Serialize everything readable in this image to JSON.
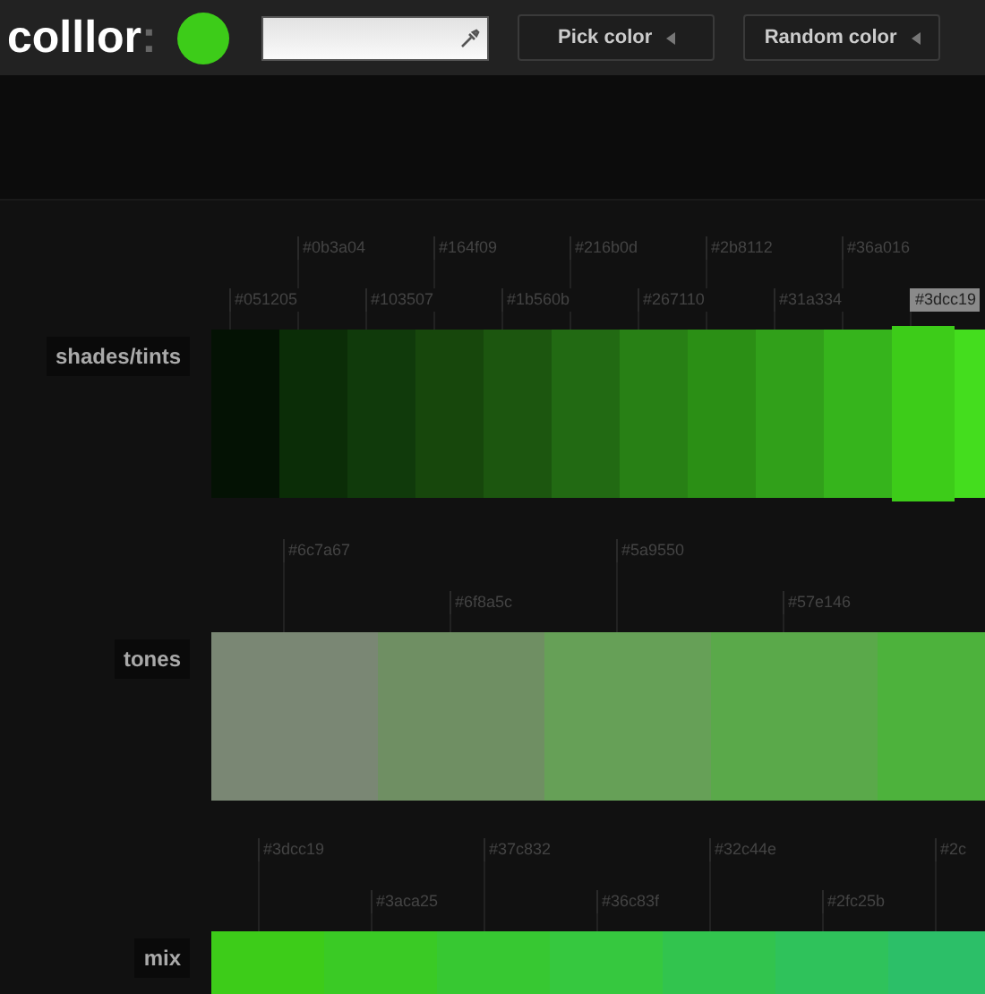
{
  "header": {
    "logo": "colllor",
    "logo_colon": ":",
    "color": "#3dcc19",
    "buttons": [
      "Pick color",
      "Random color"
    ]
  },
  "sections": [
    {
      "label": "shades/tints",
      "kind": "shades",
      "swatches": [
        {
          "color": "#041204",
          "label": "#051205",
          "selected": false
        },
        {
          "color": "#0b2d07",
          "label": "#0b3a04",
          "selected": false
        },
        {
          "color": "#103a0b",
          "label": "#103507",
          "selected": false
        },
        {
          "color": "#17470c",
          "label": "#164f09",
          "selected": false
        },
        {
          "color": "#1c560f",
          "label": "#1b560b",
          "selected": false
        },
        {
          "color": "#226a13",
          "label": "#216b0d",
          "selected": false
        },
        {
          "color": "#288015",
          "label": "#267110",
          "selected": false
        },
        {
          "color": "#2b8f15",
          "label": "#2b8112",
          "selected": false
        },
        {
          "color": "#31a01a",
          "label": "#31a334",
          "selected": false
        },
        {
          "color": "#36b41c",
          "label": "#36a016",
          "selected": false
        },
        {
          "color": "#3dcc19",
          "label": "#3dcc19",
          "selected": true
        },
        {
          "color": "#44dd1e",
          "selected": false
        }
      ]
    },
    {
      "label": "tones",
      "kind": "tones",
      "swatches": [
        {
          "color": "#7a8774",
          "label": "#6c7a67",
          "selected": false
        },
        {
          "color": "#6f8f63",
          "label": "#6f8a5c",
          "selected": false
        },
        {
          "color": "#66a057",
          "label": "#5a9550",
          "selected": false
        },
        {
          "color": "#5aa94a",
          "label": "#57e146",
          "selected": false
        },
        {
          "color": "#4db23c",
          "selected": false
        }
      ]
    },
    {
      "label": "mix",
      "kind": "mix",
      "swatches": [
        {
          "color": "#3dcc19",
          "label": "#3dcc19",
          "selected": false
        },
        {
          "color": "#3aca25",
          "label": "#3aca25",
          "selected": false
        },
        {
          "color": "#37c832",
          "label": "#37c832",
          "selected": false
        },
        {
          "color": "#36c83f",
          "label": "#36c83f",
          "selected": false
        },
        {
          "color": "#32c44e",
          "label": "#32c44e",
          "selected": false
        },
        {
          "color": "#2fc25b",
          "label": "#2fc25b",
          "selected": false
        },
        {
          "color": "#2cbf68",
          "label": "#2c",
          "selected": false
        }
      ]
    }
  ]
}
